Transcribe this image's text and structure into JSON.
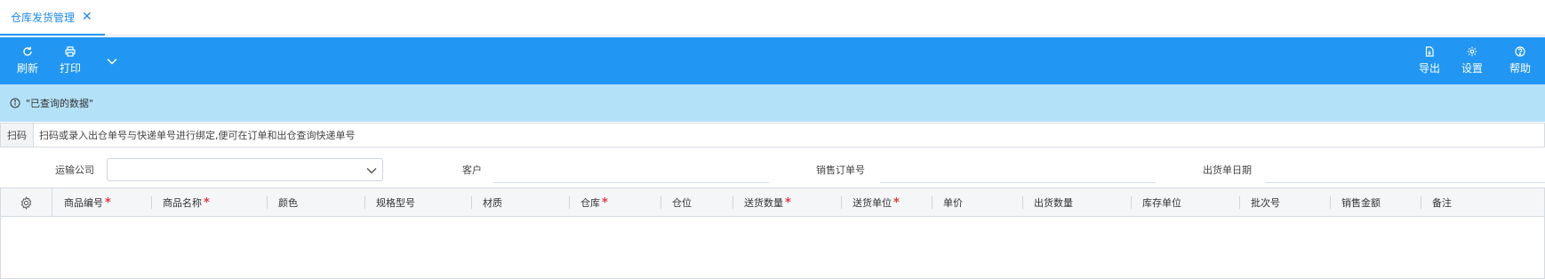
{
  "tabs": [
    {
      "label": "仓库发货管理",
      "active": true
    }
  ],
  "toolbar": {
    "refresh_label": "刷新",
    "print_label": "打印",
    "export_label": "导出",
    "settings_label": "设置",
    "help_label": "帮助"
  },
  "info": {
    "text": "\"已查询的数据\""
  },
  "scan": {
    "label": "扫码",
    "placeholder": "扫码或录入出仓单号与快递单号进行绑定,便可在订单和出仓查询快递单号",
    "value": ""
  },
  "filters": {
    "carrier_label": "运输公司",
    "carrier_value": "",
    "customer_label": "客户",
    "customer_value": "",
    "sales_order_label": "销售订单号",
    "sales_order_value": "",
    "ship_date_label": "出货单日期",
    "ship_date_value": ""
  },
  "grid": {
    "columns": [
      {
        "label": "商品编号",
        "required": true
      },
      {
        "label": "商品名称",
        "required": true
      },
      {
        "label": "颜色",
        "required": false
      },
      {
        "label": "规格型号",
        "required": false
      },
      {
        "label": "材质",
        "required": false
      },
      {
        "label": "仓库",
        "required": true
      },
      {
        "label": "仓位",
        "required": false
      },
      {
        "label": "送货数量",
        "required": true
      },
      {
        "label": "送货单位",
        "required": true
      },
      {
        "label": "单价",
        "required": false
      },
      {
        "label": "出货数量",
        "required": false
      },
      {
        "label": "库存单位",
        "required": false
      },
      {
        "label": "批次号",
        "required": false
      },
      {
        "label": "销售金额",
        "required": false
      },
      {
        "label": "备注",
        "required": false
      }
    ],
    "rows": []
  },
  "colors": {
    "primary": "#2196f3",
    "info_bg": "#b3e1f8",
    "required": "#e53935",
    "tab_active": "#1e88e5"
  },
  "icons": {
    "refresh": "refresh-icon",
    "print": "print-icon",
    "more": "chevron-down-icon",
    "export": "export-icon",
    "settings": "gear-icon",
    "help": "help-icon",
    "info": "info-icon",
    "column_settings": "gear-icon"
  }
}
